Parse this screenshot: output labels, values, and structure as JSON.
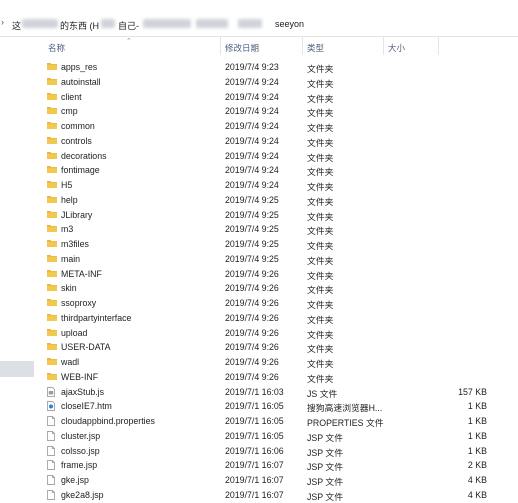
{
  "breadcrumb": {
    "segments": [
      "这",
      "的东西 (H",
      "自己-",
      "seeyon"
    ]
  },
  "columns": {
    "name": "名称",
    "date": "修改日期",
    "type": "类型",
    "size": "大小"
  },
  "files": [
    {
      "name": "apps_res",
      "date": "2019/7/4 9:23",
      "type": "文件夹",
      "size": "",
      "icon": "folder-icon"
    },
    {
      "name": "autoinstall",
      "date": "2019/7/4 9:24",
      "type": "文件夹",
      "size": "",
      "icon": "folder-icon"
    },
    {
      "name": "client",
      "date": "2019/7/4 9:24",
      "type": "文件夹",
      "size": "",
      "icon": "folder-icon"
    },
    {
      "name": "cmp",
      "date": "2019/7/4 9:24",
      "type": "文件夹",
      "size": "",
      "icon": "folder-icon"
    },
    {
      "name": "common",
      "date": "2019/7/4 9:24",
      "type": "文件夹",
      "size": "",
      "icon": "folder-icon"
    },
    {
      "name": "controls",
      "date": "2019/7/4 9:24",
      "type": "文件夹",
      "size": "",
      "icon": "folder-icon"
    },
    {
      "name": "decorations",
      "date": "2019/7/4 9:24",
      "type": "文件夹",
      "size": "",
      "icon": "folder-icon"
    },
    {
      "name": "fontimage",
      "date": "2019/7/4 9:24",
      "type": "文件夹",
      "size": "",
      "icon": "folder-icon"
    },
    {
      "name": "H5",
      "date": "2019/7/4 9:24",
      "type": "文件夹",
      "size": "",
      "icon": "folder-icon"
    },
    {
      "name": "help",
      "date": "2019/7/4 9:25",
      "type": "文件夹",
      "size": "",
      "icon": "folder-icon"
    },
    {
      "name": "JLibrary",
      "date": "2019/7/4 9:25",
      "type": "文件夹",
      "size": "",
      "icon": "folder-icon"
    },
    {
      "name": "m3",
      "date": "2019/7/4 9:25",
      "type": "文件夹",
      "size": "",
      "icon": "folder-icon"
    },
    {
      "name": "m3files",
      "date": "2019/7/4 9:25",
      "type": "文件夹",
      "size": "",
      "icon": "folder-icon"
    },
    {
      "name": "main",
      "date": "2019/7/4 9:25",
      "type": "文件夹",
      "size": "",
      "icon": "folder-icon"
    },
    {
      "name": "META-INF",
      "date": "2019/7/4 9:26",
      "type": "文件夹",
      "size": "",
      "icon": "folder-icon"
    },
    {
      "name": "skin",
      "date": "2019/7/4 9:26",
      "type": "文件夹",
      "size": "",
      "icon": "folder-icon"
    },
    {
      "name": "ssoproxy",
      "date": "2019/7/4 9:26",
      "type": "文件夹",
      "size": "",
      "icon": "folder-icon"
    },
    {
      "name": "thirdpartyinterface",
      "date": "2019/7/4 9:26",
      "type": "文件夹",
      "size": "",
      "icon": "folder-icon"
    },
    {
      "name": "upload",
      "date": "2019/7/4 9:26",
      "type": "文件夹",
      "size": "",
      "icon": "folder-icon"
    },
    {
      "name": "USER-DATA",
      "date": "2019/7/4 9:26",
      "type": "文件夹",
      "size": "",
      "icon": "folder-icon"
    },
    {
      "name": "wadl",
      "date": "2019/7/4 9:26",
      "type": "文件夹",
      "size": "",
      "icon": "folder-icon"
    },
    {
      "name": "WEB-INF",
      "date": "2019/7/4 9:26",
      "type": "文件夹",
      "size": "",
      "icon": "folder-icon"
    },
    {
      "name": "ajaxStub.js",
      "date": "2019/7/1 16:03",
      "type": "JS 文件",
      "size": "157 KB",
      "icon": "js-file-icon"
    },
    {
      "name": "closeIE7.htm",
      "date": "2019/7/1 16:05",
      "type": "搜狗高速浏览器H...",
      "size": "1 KB",
      "icon": "browser-file-icon"
    },
    {
      "name": "cloudappbind.properties",
      "date": "2019/7/1 16:05",
      "type": "PROPERTIES 文件",
      "size": "1 KB",
      "icon": "file-icon"
    },
    {
      "name": "cluster.jsp",
      "date": "2019/7/1 16:05",
      "type": "JSP 文件",
      "size": "1 KB",
      "icon": "file-icon"
    },
    {
      "name": "colsso.jsp",
      "date": "2019/7/1 16:06",
      "type": "JSP 文件",
      "size": "1 KB",
      "icon": "file-icon"
    },
    {
      "name": "frame.jsp",
      "date": "2019/7/1 16:07",
      "type": "JSP 文件",
      "size": "2 KB",
      "icon": "file-icon"
    },
    {
      "name": "gke.jsp",
      "date": "2019/7/1 16:07",
      "type": "JSP 文件",
      "size": "4 KB",
      "icon": "file-icon"
    },
    {
      "name": "gke2a8.jsp",
      "date": "2019/7/1 16:07",
      "type": "JSP 文件",
      "size": "4 KB",
      "icon": "file-icon"
    }
  ]
}
